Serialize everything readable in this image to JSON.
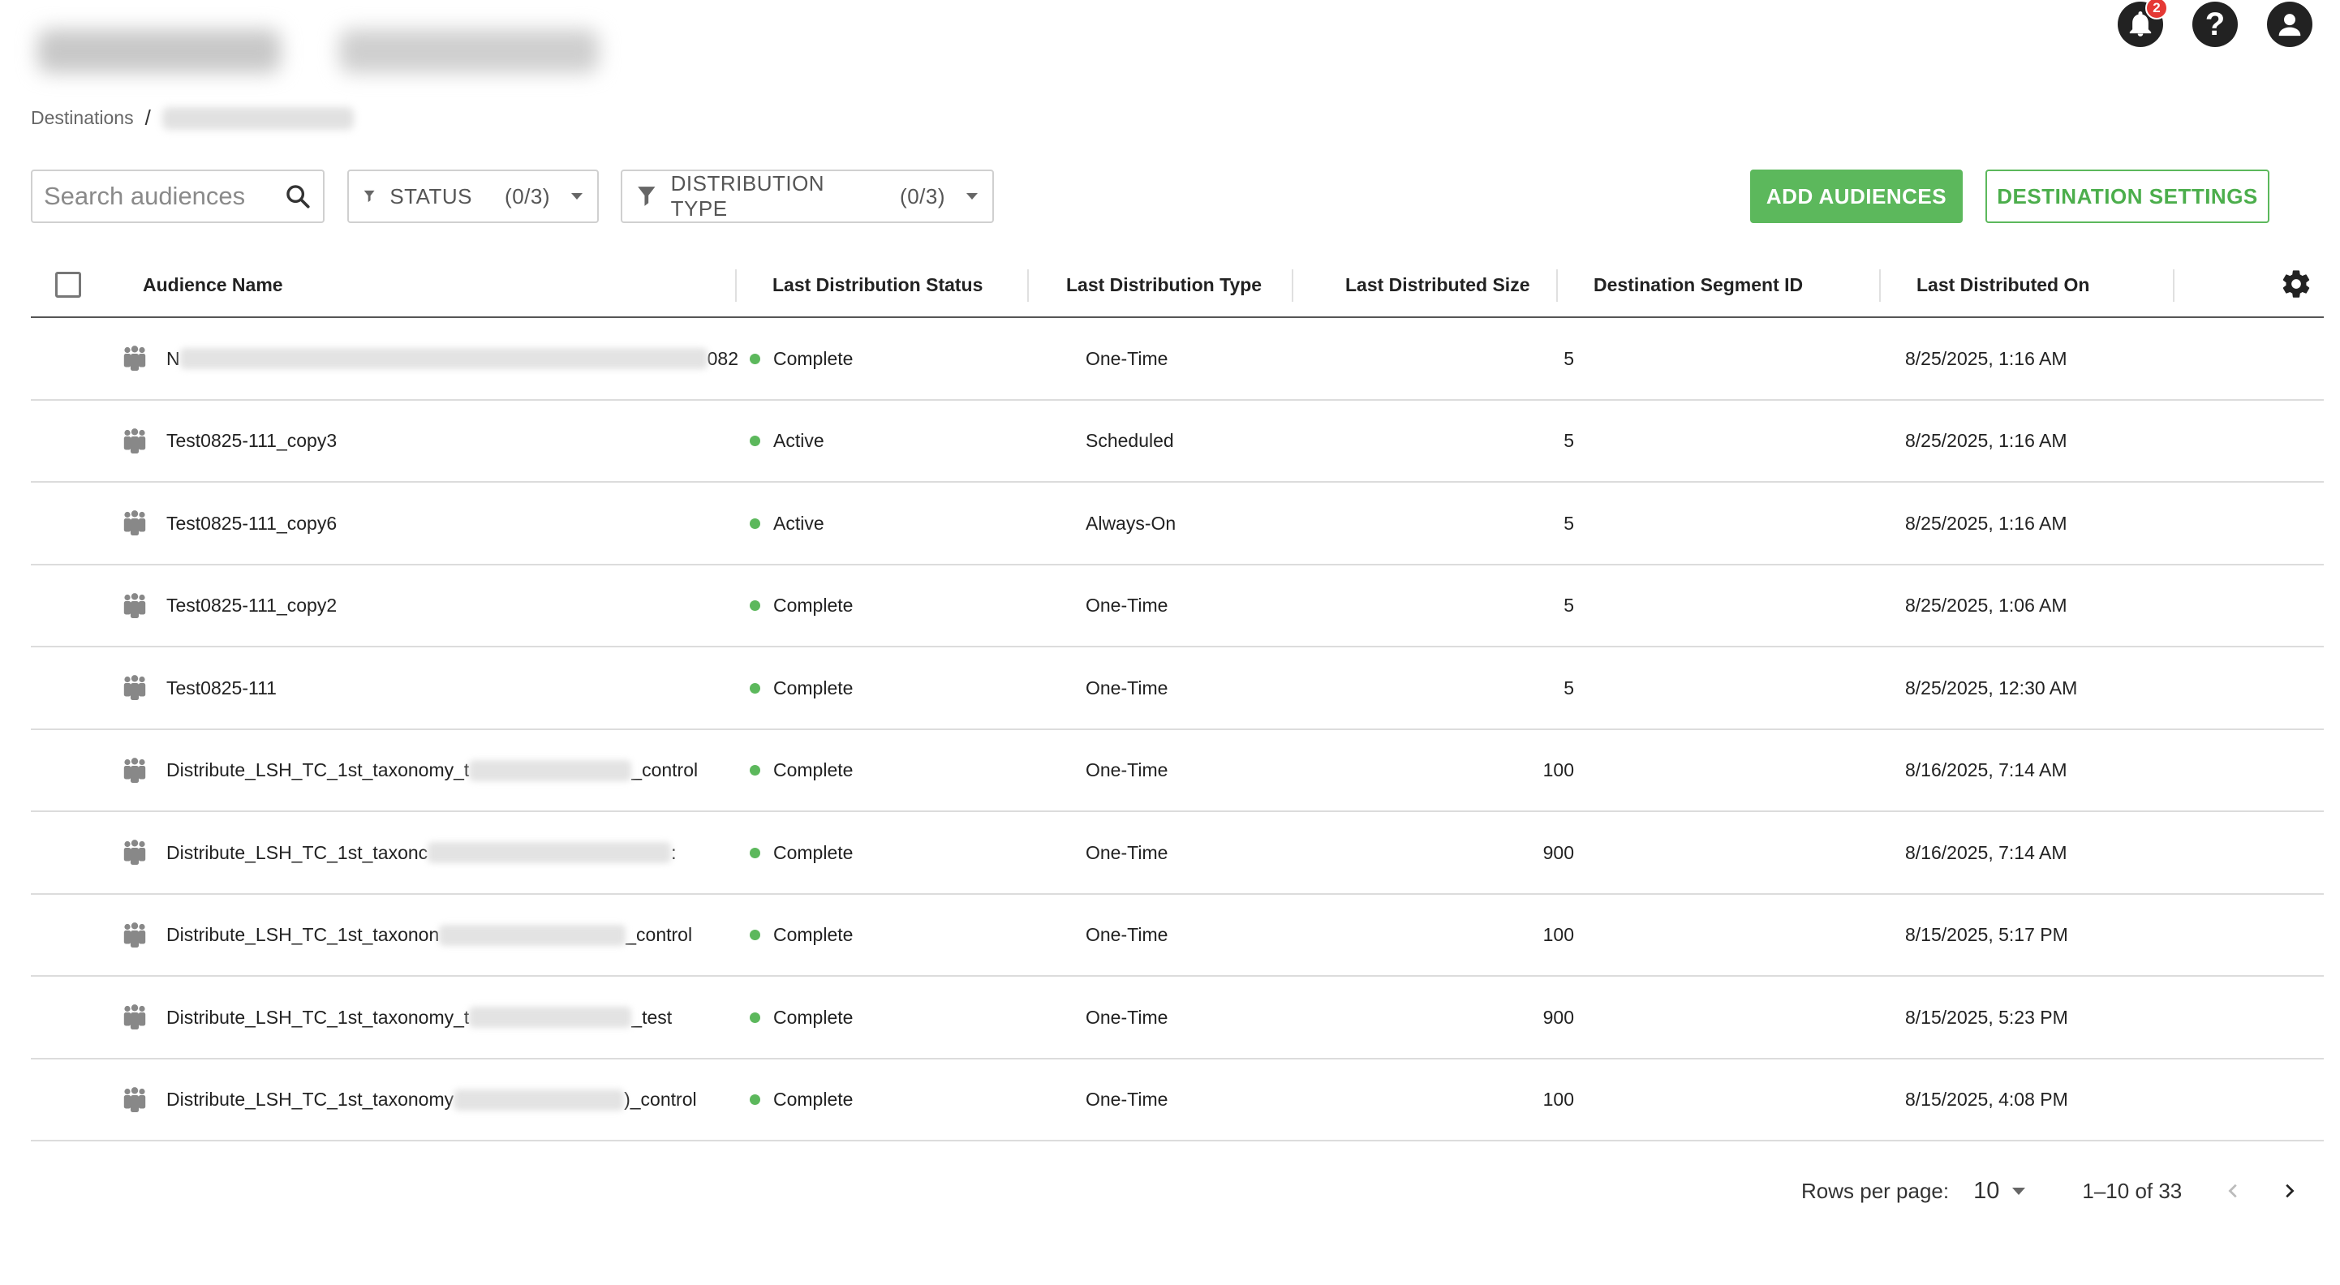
{
  "header": {
    "notifications_count": "2",
    "help_label": "?"
  },
  "breadcrumb": {
    "root": "Destinations",
    "separator": "/"
  },
  "toolbar": {
    "search_placeholder": "Search audiences",
    "status_filter": {
      "label": "STATUS",
      "count": "(0/3)"
    },
    "distribution_filter": {
      "label": "DISTRIBUTION TYPE",
      "count": "(0/3)"
    },
    "add_label": "ADD AUDIENCES",
    "settings_label": "DESTINATION SETTINGS"
  },
  "table": {
    "columns": {
      "name": "Audience Name",
      "status": "Last Distribution Status",
      "type": "Last Distribution Type",
      "size": "Last Distributed Size",
      "segment": "Destination Segment ID",
      "date": "Last Distributed On"
    },
    "rows": [
      {
        "name_prefix": "N",
        "name_suffix": "082",
        "status": "Complete",
        "type": "One-Time",
        "size": "5",
        "date": "8/25/2025, 1:16 AM"
      },
      {
        "name_prefix": "Test0825-111_copy3",
        "name_suffix": "",
        "status": "Active",
        "type": "Scheduled",
        "size": "5",
        "date": "8/25/2025, 1:16 AM"
      },
      {
        "name_prefix": "Test0825-111_copy6",
        "name_suffix": "",
        "status": "Active",
        "type": "Always-On",
        "size": "5",
        "date": "8/25/2025, 1:16 AM"
      },
      {
        "name_prefix": "Test0825-111_copy2",
        "name_suffix": "",
        "status": "Complete",
        "type": "One-Time",
        "size": "5",
        "date": "8/25/2025, 1:06 AM"
      },
      {
        "name_prefix": "Test0825-111",
        "name_suffix": "",
        "status": "Complete",
        "type": "One-Time",
        "size": "5",
        "date": "8/25/2025, 12:30 AM"
      },
      {
        "name_prefix": "Distribute_LSH_TC_1st_taxonomy_t",
        "name_suffix": "_control",
        "status": "Complete",
        "type": "One-Time",
        "size": "100",
        "date": "8/16/2025, 7:14 AM"
      },
      {
        "name_prefix": "Distribute_LSH_TC_1st_taxonc",
        "name_suffix": ":",
        "status": "Complete",
        "type": "One-Time",
        "size": "900",
        "date": "8/16/2025, 7:14 AM"
      },
      {
        "name_prefix": "Distribute_LSH_TC_1st_taxonon",
        "name_suffix": "_control",
        "status": "Complete",
        "type": "One-Time",
        "size": "100",
        "date": "8/15/2025, 5:17 PM"
      },
      {
        "name_prefix": "Distribute_LSH_TC_1st_taxonomy_t",
        "name_suffix": "_test",
        "status": "Complete",
        "type": "One-Time",
        "size": "900",
        "date": "8/15/2025, 5:23 PM"
      },
      {
        "name_prefix": "Distribute_LSH_TC_1st_taxonomy",
        "name_suffix": ")_control",
        "status": "Complete",
        "type": "One-Time",
        "size": "100",
        "date": "8/15/2025, 4:08 PM"
      }
    ]
  },
  "pagination": {
    "rows_per_page_label": "Rows per page:",
    "rows_per_page_value": "10",
    "range_label": "1–10 of 33"
  },
  "colors": {
    "accent_green": "#5cb85c",
    "badge_red": "#e53935"
  },
  "icons": [
    "bell-icon",
    "help-icon",
    "account-icon",
    "search-icon",
    "filter-icon",
    "gear-icon",
    "audience-group-icon",
    "chevron-left-icon",
    "chevron-right-icon"
  ]
}
